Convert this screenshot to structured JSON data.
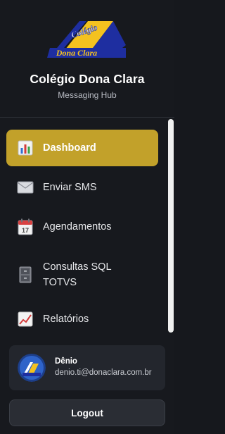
{
  "logo": {
    "line1": "Colégio",
    "line2": "Dona Clara"
  },
  "brand": {
    "title": "Colégio Dona Clara",
    "subtitle": "Messaging Hub"
  },
  "nav": {
    "items": [
      {
        "label": "Dashboard",
        "icon": "bar-chart-icon",
        "active": true
      },
      {
        "label": "Enviar SMS",
        "icon": "envelope-icon",
        "active": false
      },
      {
        "label": "Agendamentos",
        "icon": "calendar-icon",
        "active": false
      },
      {
        "label": "Consultas SQL",
        "label2": "TOTVS",
        "icon": "file-cabinet-icon",
        "active": false
      },
      {
        "label": "Relatórios",
        "icon": "trend-chart-icon",
        "active": false
      }
    ]
  },
  "user": {
    "name": "Dênio",
    "email": "denio.ti@donaclara.com.br"
  },
  "logout": {
    "label": "Logout"
  },
  "colors": {
    "accent": "#c2a12a",
    "background": "#17191e",
    "card": "#23262d"
  }
}
